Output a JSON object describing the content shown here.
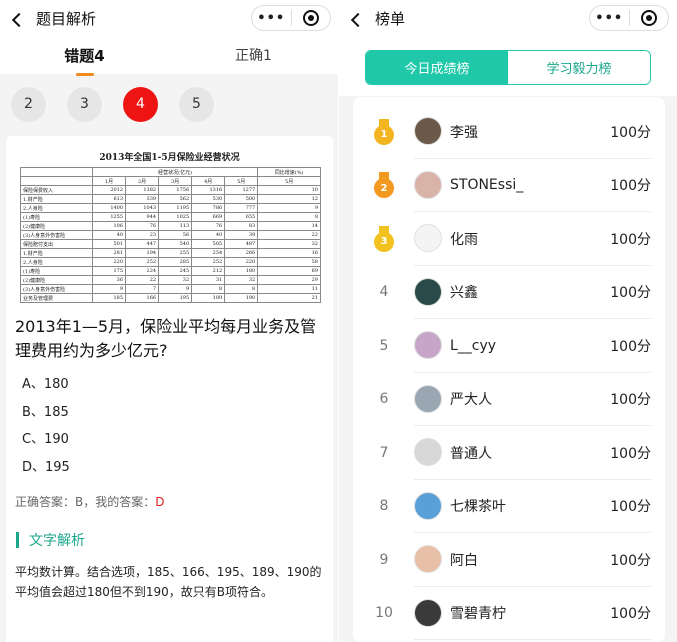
{
  "left": {
    "nav_title": "题目解析",
    "capsule_dots": "•••",
    "tabs": [
      {
        "label": "错题4",
        "active": true
      },
      {
        "label": "正确1",
        "active": false
      }
    ],
    "question_numbers": [
      {
        "label": "2",
        "active": false
      },
      {
        "label": "3",
        "active": false
      },
      {
        "label": "4",
        "active": true
      },
      {
        "label": "5",
        "active": false
      }
    ],
    "table": {
      "title": "2013年全国1-5月保险业经营状况",
      "header1": [
        "",
        "经营状况(亿元)",
        "同比增速(%)"
      ],
      "header2": [
        "",
        "1月",
        "2月",
        "3月",
        "4月",
        "5月",
        "5月"
      ],
      "rows": [
        [
          "保险保费收入",
          "2012",
          "1382",
          "1756",
          "1316",
          "1277",
          "10"
        ],
        [
          "1.财产险",
          "613",
          "339",
          "562",
          "530",
          "500",
          "12"
        ],
        [
          "2.人身险",
          "1400",
          "1043",
          "1195",
          "786",
          "777",
          "9"
        ],
        [
          "(1)寿险",
          "1255",
          "944",
          "1025",
          "669",
          "655",
          "8"
        ],
        [
          "(2)健康险",
          "106",
          "76",
          "113",
          "76",
          "83",
          "14"
        ],
        [
          "(3)人身意外伤害险",
          "40",
          "23",
          "56",
          "40",
          "39",
          "22"
        ],
        [
          "保险赔付支出",
          "501",
          "447",
          "540",
          "505",
          "487",
          "32"
        ],
        [
          "1.财产险",
          "281",
          "194",
          "255",
          "254",
          "266",
          "16"
        ],
        [
          "2.人身险",
          "220",
          "252",
          "285",
          "252",
          "220",
          "58"
        ],
        [
          "(1)寿险",
          "175",
          "224",
          "245",
          "212",
          "180",
          "69"
        ],
        [
          "(2)健康险",
          "36",
          "22",
          "32",
          "31",
          "32",
          "29"
        ],
        [
          "(3)人身意外伤害险",
          "9",
          "7",
          "9",
          "8",
          "8",
          "11"
        ],
        [
          "业务及管理费",
          "185",
          "166",
          "195",
          "189",
          "190",
          "21"
        ]
      ]
    },
    "question": "2013年1—5月，保险业平均每月业务及管理费用约为多少亿元?",
    "options": [
      "A、180",
      "B、185",
      "C、190",
      "D、195"
    ],
    "answer_prefix": "正确答案：B，我的答案：",
    "my_answer": "D",
    "analysis_title": "文字解析",
    "analysis_text": "平均数计算。结合选项，185、166、195、189、190的平均值会超过180但不到190，故只有B项符合。"
  },
  "right": {
    "nav_title": "榜单",
    "capsule_dots": "•••",
    "segments": [
      {
        "label": "今日成绩榜",
        "active": true
      },
      {
        "label": "学习毅力榜",
        "active": false
      }
    ],
    "ranking": [
      {
        "rank": "1",
        "name": "李强",
        "score": "100分"
      },
      {
        "rank": "2",
        "name": "STONEssi_",
        "score": "100分"
      },
      {
        "rank": "3",
        "name": "化雨",
        "score": "100分"
      },
      {
        "rank": "4",
        "name": "兴鑫",
        "score": "100分"
      },
      {
        "rank": "5",
        "name": "L__cyy",
        "score": "100分"
      },
      {
        "rank": "6",
        "name": "严大人",
        "score": "100分"
      },
      {
        "rank": "7",
        "name": "普通人",
        "score": "100分"
      },
      {
        "rank": "8",
        "name": "七棵茶叶",
        "score": "100分"
      },
      {
        "rank": "9",
        "name": "阿白",
        "score": "100分"
      },
      {
        "rank": "10",
        "name": "雪碧青柠",
        "score": "100分"
      }
    ],
    "medal_colors": [
      "#f2b51f",
      "#f29a1f",
      "#f2c21f"
    ]
  }
}
